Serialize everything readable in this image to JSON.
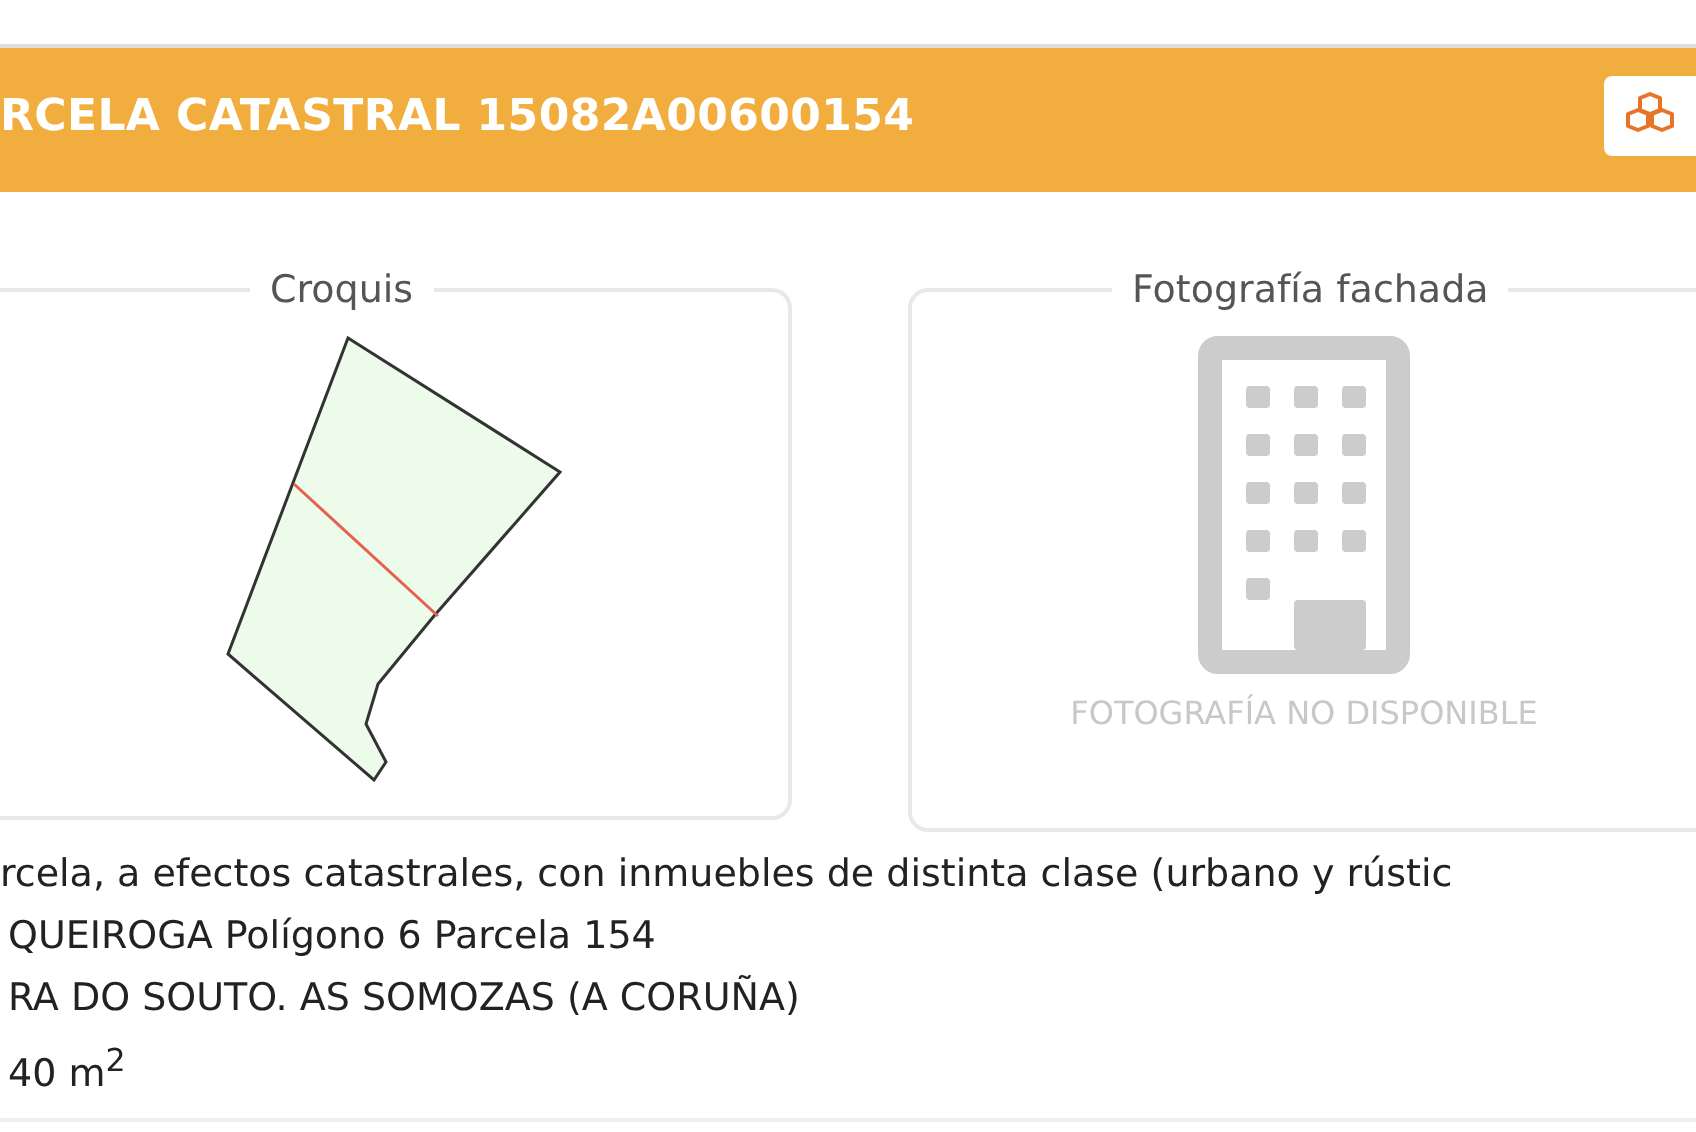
{
  "header": {
    "title": "RCELA CATASTRAL 15082A00600154"
  },
  "panels": [
    {
      "kind": "sketch",
      "title": "Croquis"
    },
    {
      "kind": "photo",
      "title": "Fotografía fachada",
      "notice": "FOTOGRAFÍA NO DISPONIBLE"
    }
  ],
  "details": [
    "rcela, a efectos catastrales, con inmuebles de distinta clase (urbano y rústic",
    "QUEIROGA Polígono 6 Parcela 154",
    "RA DO SOUTO. AS SOMOZAS (A CORUÑA)",
    "40 m$^{2}$"
  ]
}
